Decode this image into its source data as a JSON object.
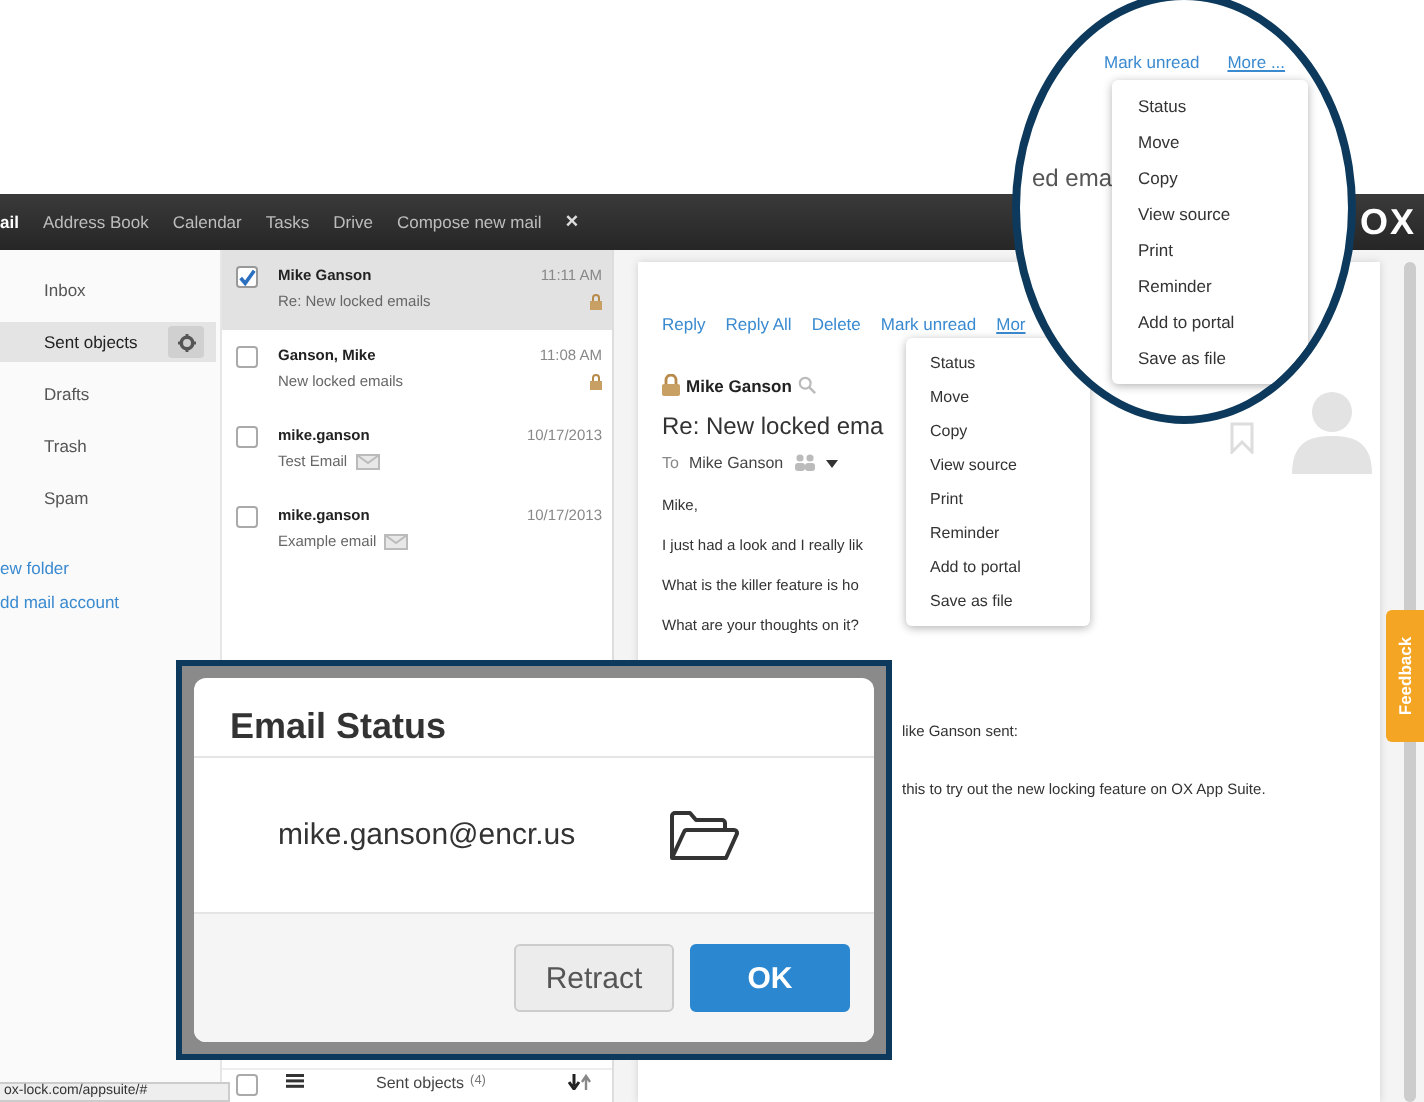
{
  "top_bar": {
    "items": [
      {
        "label": "ail",
        "selected": true
      },
      {
        "label": "Address Book",
        "selected": false
      },
      {
        "label": "Calendar",
        "selected": false
      },
      {
        "label": "Tasks",
        "selected": false
      },
      {
        "label": "Drive",
        "selected": false
      },
      {
        "label": "Compose new mail",
        "selected": false
      }
    ],
    "close": "×",
    "logo": "OX"
  },
  "sidebar": {
    "folders": [
      {
        "label": "Inbox",
        "selected": false
      },
      {
        "label": "Sent objects",
        "selected": true
      },
      {
        "label": "Drafts",
        "selected": false
      },
      {
        "label": "Trash",
        "selected": false
      },
      {
        "label": "Spam",
        "selected": false
      }
    ],
    "links": [
      "ew folder",
      "dd mail account"
    ]
  },
  "mail_list": {
    "items": [
      {
        "sender": "Mike Ganson",
        "subject": "Re: New locked emails",
        "time": "11:11 AM",
        "kind": "locked",
        "checked": true,
        "selected": true
      },
      {
        "sender": "Ganson, Mike",
        "subject": "New locked emails",
        "time": "11:08 AM",
        "kind": "locked",
        "checked": false,
        "selected": false
      },
      {
        "sender": "mike.ganson",
        "subject": "Test Email",
        "time": "10/17/2013",
        "kind": "plain",
        "checked": false,
        "selected": false
      },
      {
        "sender": "mike.ganson",
        "subject": "Example email",
        "time": "10/17/2013",
        "kind": "plain",
        "checked": false,
        "selected": false
      }
    ],
    "footer": {
      "select_all": {
        "checked": false
      },
      "folder": "Sent objects",
      "count": "(4)"
    }
  },
  "detail": {
    "actions": [
      "Reply",
      "Reply All",
      "Delete",
      "Mark unread",
      "Mor"
    ],
    "sender": "Mike Ganson",
    "subject": "Re: New locked ema",
    "to_label": "To",
    "to": "Mike Ganson",
    "body": [
      "Mike,",
      "I just had a look and I really lik",
      "What is the killer feature is ho",
      "What are your thoughts on it?"
    ],
    "quote": [
      "like Ganson sent:",
      "this to try out the new locking feature on OX App Suite."
    ]
  },
  "more_menu": {
    "items": [
      "Status",
      "Move",
      "Copy",
      "View source",
      "Print",
      "Reminder",
      "Add to portal",
      "Save as file"
    ]
  },
  "magnifier": {
    "fragment": "ed ema",
    "actions": [
      "Mark unread",
      "More ..."
    ],
    "menu": [
      "Status",
      "Move",
      "Copy",
      "View source",
      "Print",
      "Reminder",
      "Add to portal",
      "Save as file"
    ]
  },
  "status_dialog": {
    "title": "Email Status",
    "recipient": "mike.ganson@encr.us",
    "buttons": [
      {
        "label": "Retract",
        "kind": "default"
      },
      {
        "label": "OK",
        "kind": "primary"
      }
    ]
  },
  "feedback": "Feedback",
  "status_url": "ox-lock.com/appsuite/#"
}
